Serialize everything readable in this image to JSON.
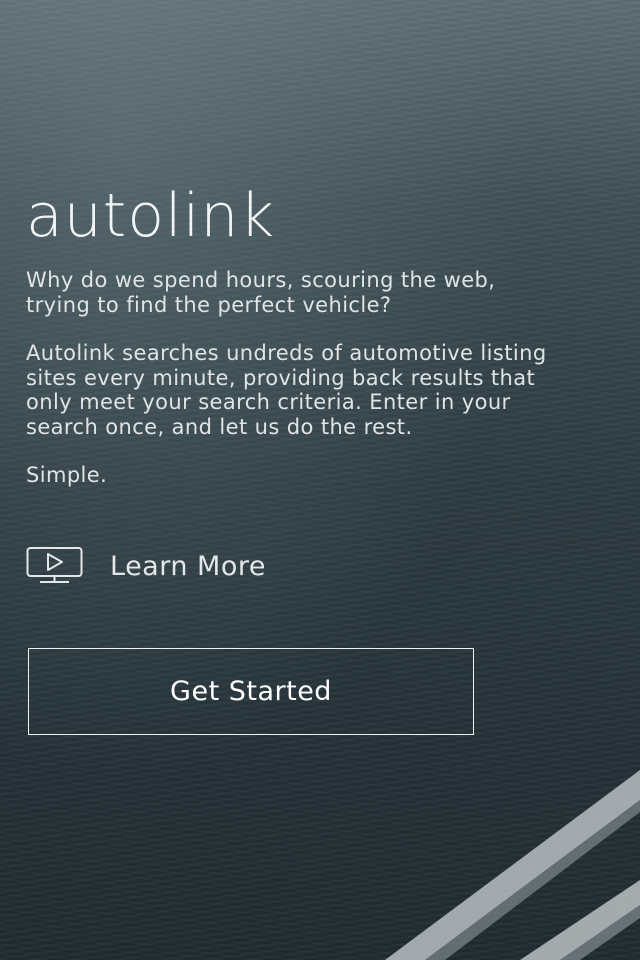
{
  "brand": {
    "logo_text": "autolink"
  },
  "intro": {
    "paragraph_1": "Why do we spend hours, scouring the web,\ntrying to find the perfect vehicle?",
    "paragraph_2": "Autolink searches undreds of automotive listing\nsites every minute, providing back results that\nonly meet your search criteria.  Enter in your\nsearch once, and let us do the rest.",
    "paragraph_3": "Simple."
  },
  "learn_more": {
    "icon": "tv-play-icon",
    "label": "Learn More"
  },
  "actions": {
    "get_started_label": "Get Started"
  },
  "colors": {
    "text": "#e6eaec",
    "background": "#2a3940",
    "button_border": "#eef1f2"
  }
}
